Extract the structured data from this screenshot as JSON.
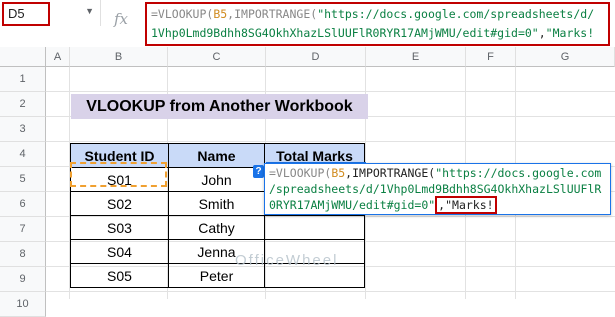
{
  "name_box": {
    "value": "D5"
  },
  "formula_bar": {
    "fx_label": "fx",
    "line1_func": "=VLOOKUP(",
    "line1_ref": "B5",
    "line1_mid": ",IMPORTRANGE(",
    "line1_str": "\"https://docs.google.com/spreadsheets/d/",
    "line2_str": "1Vhp0Lmd9Bdhh8SG4OkhXhazLSlUUFlR0RYR17AMjWMU/edit#gid=0\"",
    "line2_sep": ",",
    "line2_str2": "\"Marks!"
  },
  "columns": [
    "A",
    "B",
    "C",
    "D",
    "E",
    "F",
    "G"
  ],
  "rows": [
    "1",
    "2",
    "3",
    "4",
    "5",
    "6",
    "7",
    "8",
    "9",
    "10"
  ],
  "title": "VLOOKUP from Another Workbook",
  "table": {
    "headers": [
      "Student ID",
      "Name",
      "Total Marks"
    ],
    "rows": [
      [
        "S01",
        "John",
        ""
      ],
      [
        "S02",
        "Smith",
        ""
      ],
      [
        "S03",
        "Cathy",
        ""
      ],
      [
        "S04",
        "Jenna",
        ""
      ],
      [
        "S05",
        "Peter",
        ""
      ]
    ]
  },
  "popup": {
    "line1_func": "=VLOOKUP(",
    "line1_ref": "B5",
    "line1_mid": ",IMPORTRANGE(",
    "line1_str": "\"https://docs.google.com",
    "line2_str": "/spreadsheets/d/1Vhp0Lmd9Bdhh8SG4OkhXhazLSlUUFlR",
    "line3_str": "0RYR17AMjWMU/edit#gid=0\"",
    "line3_hl": ",\"Marks!",
    "badge": "?"
  },
  "watermark": "OfficeWheel"
}
